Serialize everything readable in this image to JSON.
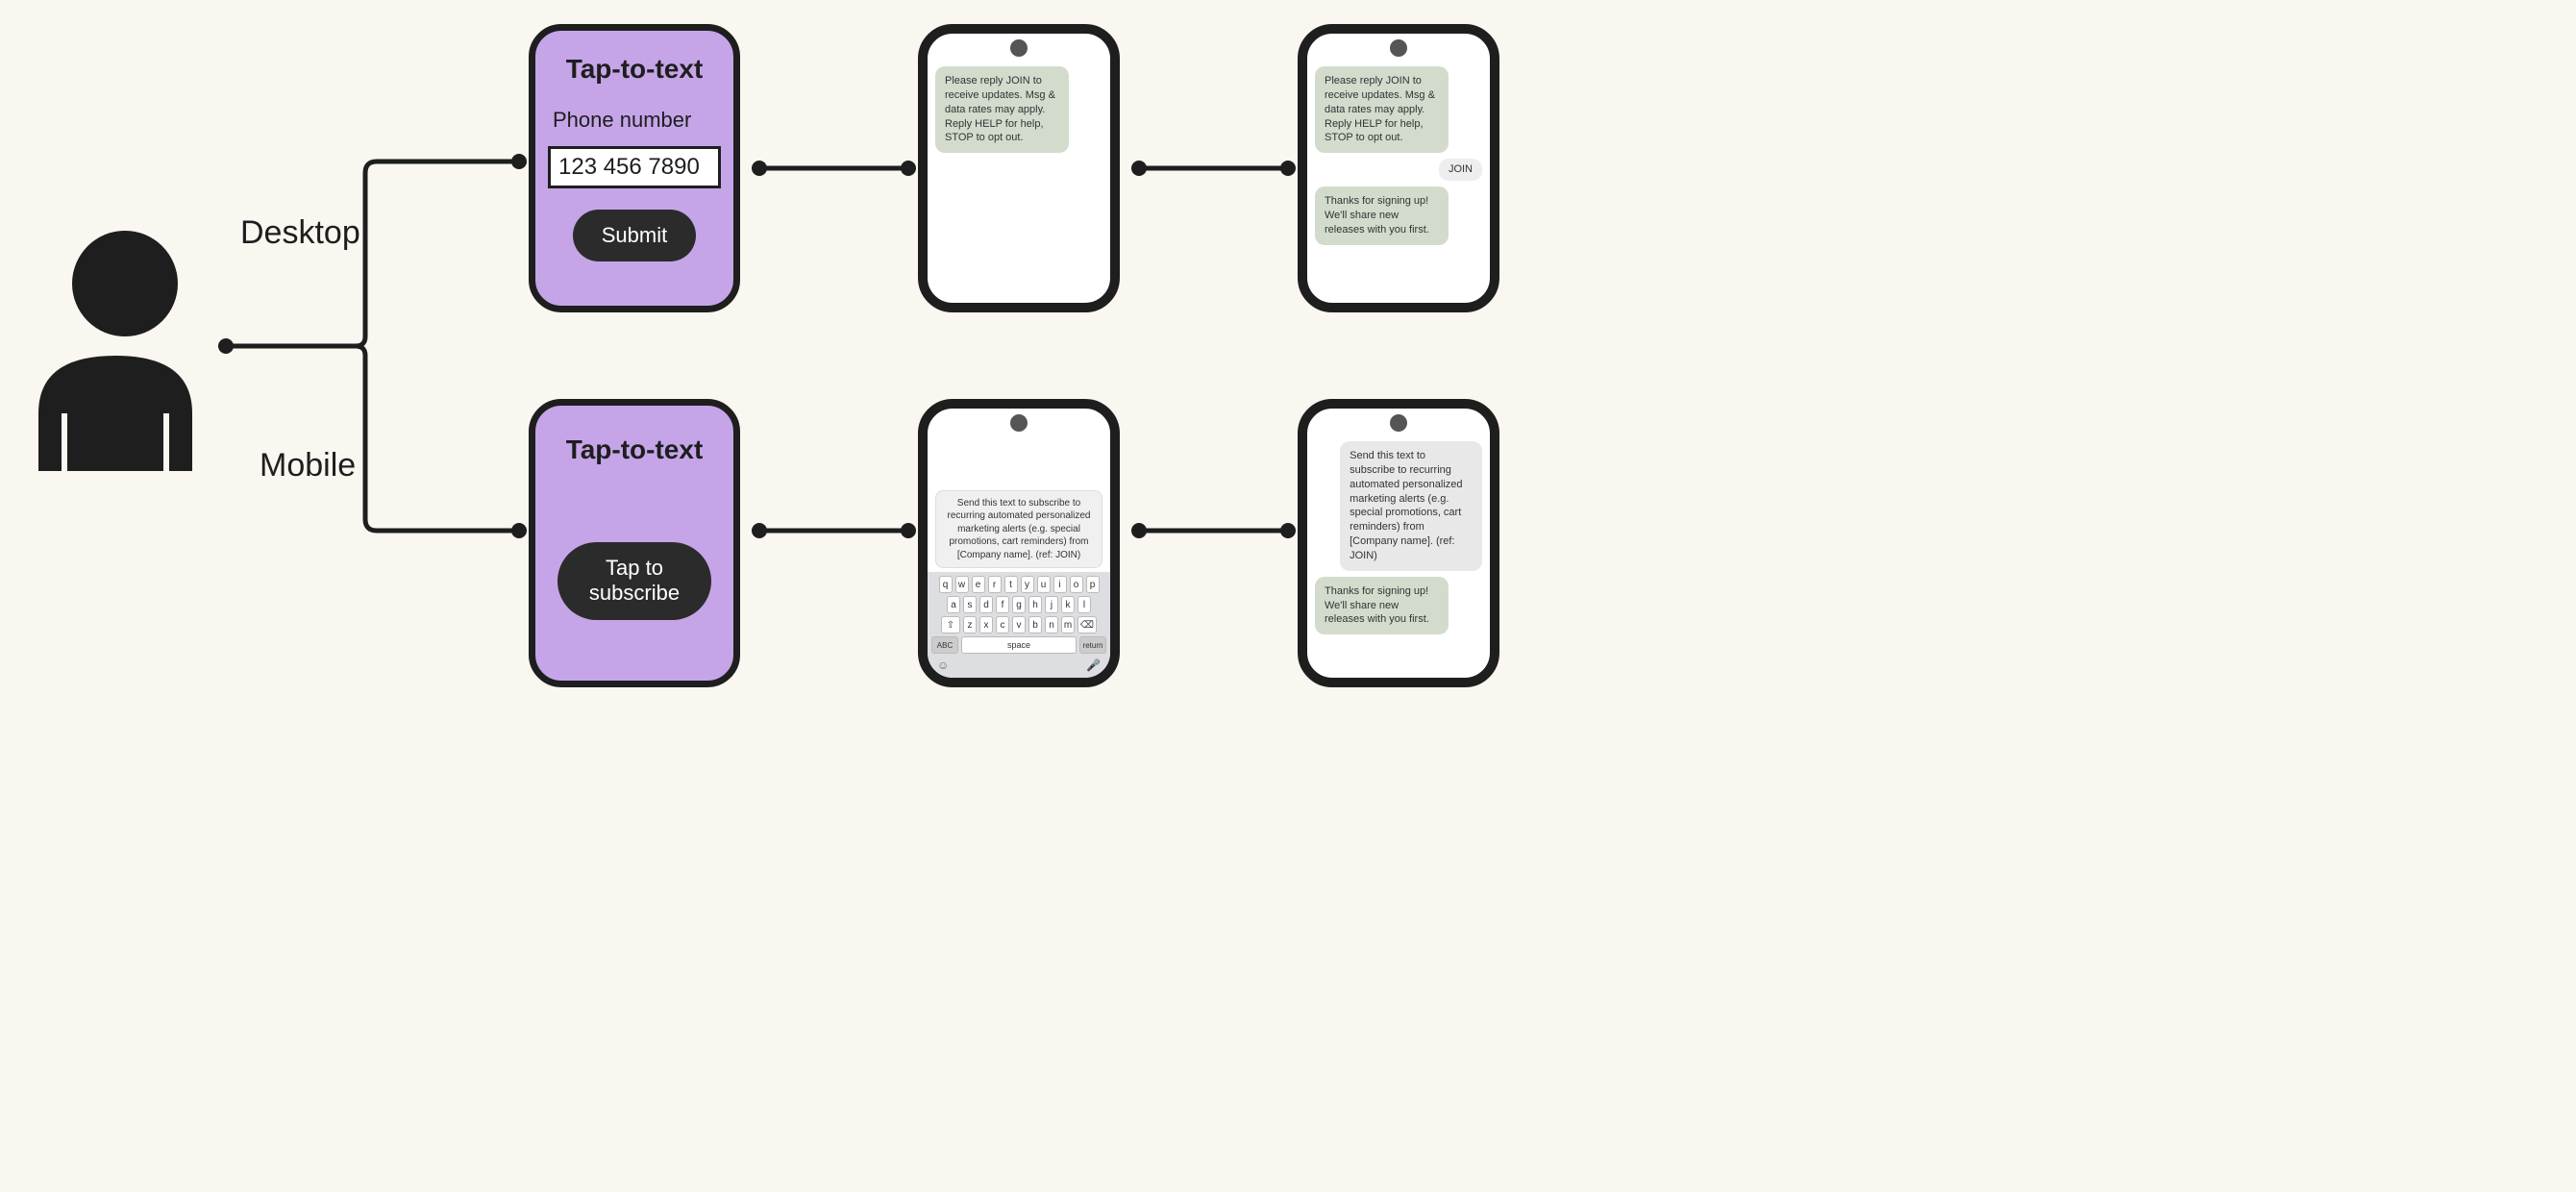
{
  "branches": {
    "desktop_label": "Desktop",
    "mobile_label": "Mobile"
  },
  "desktop_card": {
    "title": "Tap-to-text",
    "field_label": "Phone number",
    "field_value": "123 456 7890",
    "submit_label": "Submit"
  },
  "mobile_card": {
    "title": "Tap-to-text",
    "button_label": "Tap to subscribe"
  },
  "phone_desktop_1": {
    "msg1": "Please reply JOIN to receive updates. Msg & data rates may apply. Reply HELP for help, STOP to opt out."
  },
  "phone_desktop_2": {
    "msg1": "Please reply JOIN to receive updates. Msg & data rates may apply. Reply HELP for help, STOP to opt out.",
    "reply": "JOIN",
    "msg2": "Thanks for signing up! We'll share new releases with you first."
  },
  "phone_mobile_1": {
    "compose": "Send this text to subscribe to recurring automated personalized marketing alerts (e.g. special promotions, cart reminders) from [Company name]. (ref: JOIN)",
    "keyboard": {
      "row1": [
        "q",
        "w",
        "e",
        "r",
        "t",
        "y",
        "u",
        "i",
        "o",
        "p"
      ],
      "row2": [
        "a",
        "s",
        "d",
        "f",
        "g",
        "h",
        "j",
        "k",
        "l"
      ],
      "row3": [
        "⇧",
        "z",
        "x",
        "c",
        "v",
        "b",
        "n",
        "m",
        "⌫"
      ],
      "abc": "ABC",
      "space": "space",
      "return": "return"
    }
  },
  "phone_mobile_2": {
    "msg1": "Send this text to subscribe to recurring automated personalized marketing alerts (e.g. special promotions, cart reminders) from [Company name]. (ref: JOIN)",
    "msg2": "Thanks for signing up! We'll share new releases with you first."
  }
}
